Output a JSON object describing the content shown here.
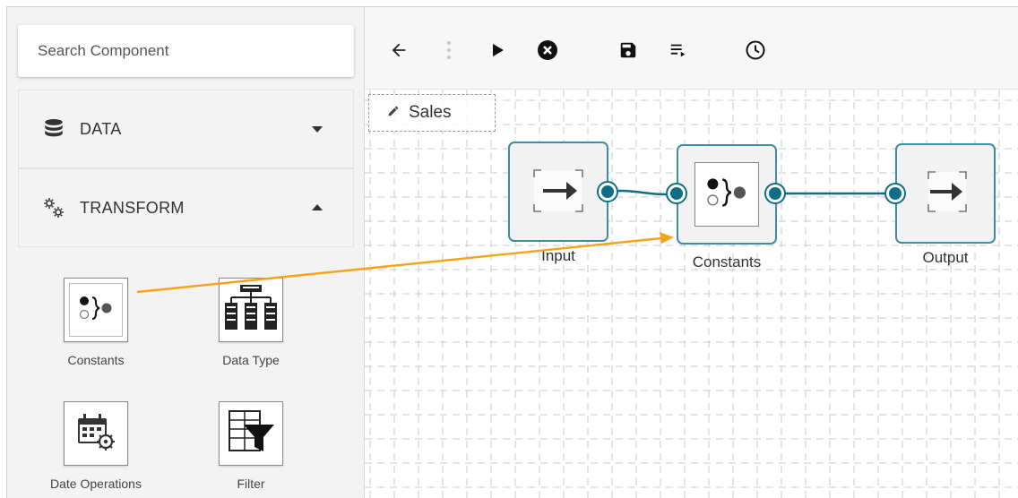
{
  "sidebar": {
    "search": {
      "placeholder": "Search Component"
    },
    "categories": [
      {
        "label": "DATA",
        "icon": "database-icon",
        "state": "collapsed"
      },
      {
        "label": "TRANSFORM",
        "icon": "gears-icon",
        "state": "expanded"
      }
    ],
    "components": [
      {
        "label": "Constants",
        "icon": "constants-icon"
      },
      {
        "label": "Data Type",
        "icon": "data-type-icon"
      },
      {
        "label": "Date Operations",
        "icon": "date-operations-icon"
      },
      {
        "label": "Filter",
        "icon": "filter-icon"
      }
    ]
  },
  "toolbar": {
    "buttons": [
      {
        "name": "back",
        "icon": "arrow-left-icon"
      },
      {
        "name": "more",
        "icon": "vertical-dots-icon"
      },
      {
        "name": "run",
        "icon": "play-icon"
      },
      {
        "name": "stop",
        "icon": "close-circle-icon"
      },
      {
        "name": "save",
        "icon": "save-icon"
      },
      {
        "name": "logs",
        "icon": "playlist-icon"
      },
      {
        "name": "history",
        "icon": "clock-icon"
      }
    ]
  },
  "canvas": {
    "tab_name": "Sales",
    "nodes": [
      {
        "label": "Input",
        "icon": "input-icon"
      },
      {
        "label": "Constants",
        "icon": "constants-icon"
      },
      {
        "label": "Output",
        "icon": "output-icon"
      }
    ]
  },
  "colors": {
    "node_border": "#3c8ea0",
    "port": "#0f6e86",
    "drag_arrow": "#f7a21b",
    "grid_line": "#c8c8c8"
  }
}
